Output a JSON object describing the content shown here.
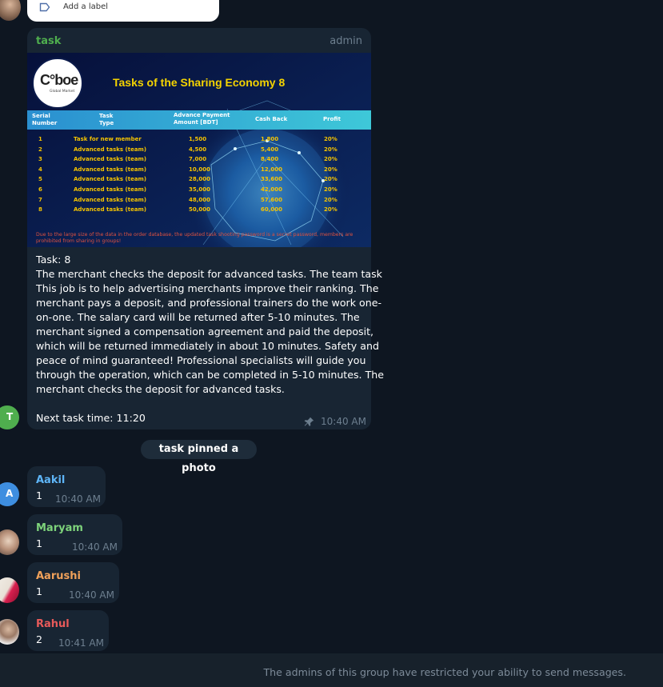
{
  "popup": {
    "label": "Add a label",
    "icon": "label-tag-icon"
  },
  "pinned_message": {
    "sender": "task",
    "role": "admin",
    "avatar_letter": "T",
    "banner": {
      "logo_text": "C°boe",
      "logo_sub": "Global Market",
      "title": "Tasks of the Sharing Economy 8",
      "headers": [
        "Serial Number",
        "Task Type",
        "Advance Payment Amount [BDT]",
        "Cash Back",
        "Profit"
      ],
      "rows": [
        [
          "1",
          "Task for new member",
          "1,500",
          "1,800",
          "20%"
        ],
        [
          "2",
          "Advanced tasks (team)",
          "4,500",
          "5,400",
          "20%"
        ],
        [
          "3",
          "Advanced tasks (team)",
          "7,000",
          "8,400",
          "20%"
        ],
        [
          "4",
          "Advanced tasks (team)",
          "10,000",
          "12,000",
          "20%"
        ],
        [
          "5",
          "Advanced tasks (team)",
          "28,000",
          "33,600",
          "20%"
        ],
        [
          "6",
          "Advanced tasks (team)",
          "35,000",
          "42,000",
          "20%"
        ],
        [
          "7",
          "Advanced tasks (team)",
          "48,000",
          "57,600",
          "20%"
        ],
        [
          "8",
          "Advanced tasks (team)",
          "50,000",
          "60,000",
          "20%"
        ]
      ],
      "footnote": "Due to the large size of the data in the order database, the updated task shooting password is a secret password, members are prohibited from sharing in groups!"
    },
    "text_lines": [
      "Task: 8",
      "The merchant checks the deposit for advanced tasks. The team task",
      "This job is to help advertising merchants improve their ranking. The",
      "merchant pays a deposit, and professional trainers do the work one-",
      "on-one. The salary card will be returned after 5-10 minutes. The",
      "merchant signed a compensation agreement and paid the deposit,",
      "which will be returned immediately in about 10 minutes. Safety and",
      "peace of mind guaranteed! Professional specialists will guide you",
      "through the operation, which can be completed in 5-10 minutes. The",
      "merchant checks the deposit for advanced tasks.",
      "",
      "Next task time: 11:20"
    ],
    "time": "10:40 AM",
    "pin_icon": "pin-icon"
  },
  "system_message": "task pinned a photo",
  "messages": [
    {
      "sender": "Aakil",
      "text": "1",
      "time": "10:40 AM",
      "color": "#5eb5f7",
      "avatar_letter": "A",
      "avatar_color": "#3e8ee0"
    },
    {
      "sender": "Maryam",
      "text": "1",
      "time": "10:40 AM",
      "color": "#7ed37b"
    },
    {
      "sender": "Aarushi",
      "text": "1",
      "time": "10:40 AM",
      "color": "#f0a15a"
    },
    {
      "sender": "Rahul",
      "text": "2",
      "time": "10:41 AM",
      "color": "#e85a5a"
    }
  ],
  "footer_notice": "The admins of this group have restricted your ability to send messages.",
  "colors": {
    "background": "#0e1621",
    "bubble": "#182533",
    "accent_green": "#4fae4e",
    "admin_text": "#6d7f8f"
  }
}
